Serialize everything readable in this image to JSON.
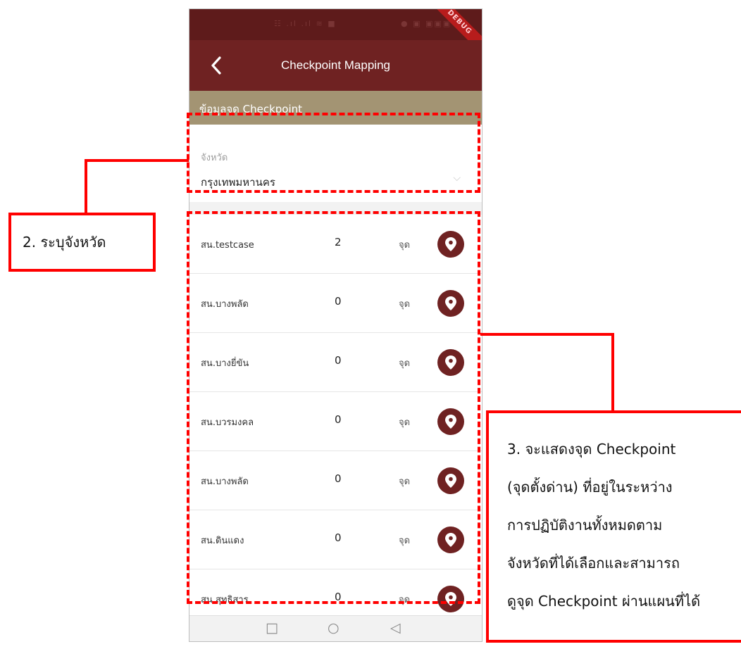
{
  "status_bar": {
    "left_glyphs": "☷ .ıl .ıl ≋ ■",
    "right_glyphs": "● ▣ ▣▣▣"
  },
  "debug_banner": "DEBUG",
  "app_bar": {
    "title": "Checkpoint Mapping",
    "back_icon": "chevron-left-icon"
  },
  "section": {
    "title": "ข้อมูลจุด Checkpoint"
  },
  "province": {
    "label": "จังหวัด",
    "value": "กรุงเทพมหานคร",
    "chevron": "⌵"
  },
  "checkpoints": [
    {
      "name": "สน.testcase",
      "count": "2",
      "unit": "จุด"
    },
    {
      "name": "สน.บางพลัด",
      "count": "0",
      "unit": "จุด"
    },
    {
      "name": "สน.บางยี่ขัน",
      "count": "0",
      "unit": "จุด"
    },
    {
      "name": "สน.บวรมงคล",
      "count": "0",
      "unit": "จุด"
    },
    {
      "name": "สน.บางพลัด",
      "count": "0",
      "unit": "จุด"
    },
    {
      "name": "สน.ดินแดง",
      "count": "0",
      "unit": "จุด"
    },
    {
      "name": "สน.สุทธิสาร",
      "count": "0",
      "unit": "จุด"
    }
  ],
  "nav": {
    "recent": "□",
    "home": "○",
    "back": "◁"
  },
  "annotations": {
    "callout_2": "2. ระบุจังหวัด",
    "callout_3_lines": [
      "3. จะแสดงจุด Checkpoint",
      "(จุดตั้งด่าน) ที่อยู่ในระหว่าง",
      "การปฏิบัติงานทั้งหมดตาม",
      "จังหวัดที่ได้เลือกและสามารถ",
      "ดูจุด Checkpoint ผ่านแผนที่ได้"
    ]
  },
  "colors": {
    "accent": "#6f2222",
    "status_bar": "#5e1b1b",
    "section": "#a39473",
    "annotation": "#ff0000"
  }
}
